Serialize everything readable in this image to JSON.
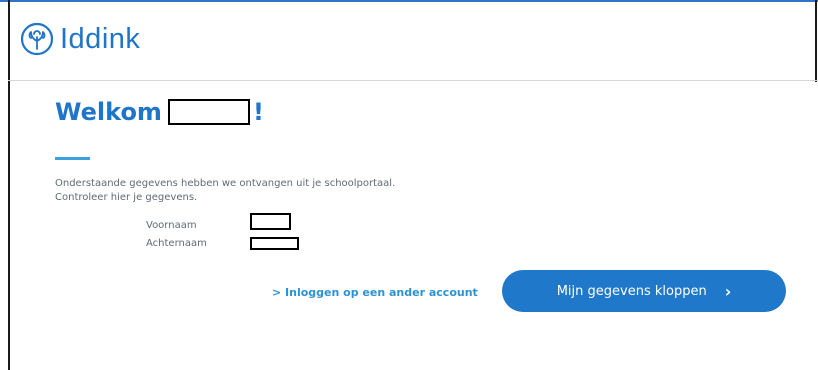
{
  "brand": {
    "name": "Iddink",
    "logo_icon": "iddink-logo-icon",
    "color": "#1f75c9"
  },
  "welcome": {
    "prefix": "Welkom",
    "suffix": "!",
    "name_redacted": true
  },
  "intro": {
    "line1": "Onderstaande gegevens hebben we ontvangen uit je schoolportaal.",
    "line2": "Controleer hier je gegevens."
  },
  "fields": [
    {
      "label": "Voornaam",
      "value_redacted": true
    },
    {
      "label": "Achternaam",
      "value_redacted": true
    }
  ],
  "actions": {
    "alt_link": "> Inloggen op een ander account",
    "confirm_label": "Mijn gegevens kloppen",
    "confirm_icon": "chevron-right-icon",
    "confirm_color": "#1f78c9",
    "link_color": "#2b93d6"
  }
}
